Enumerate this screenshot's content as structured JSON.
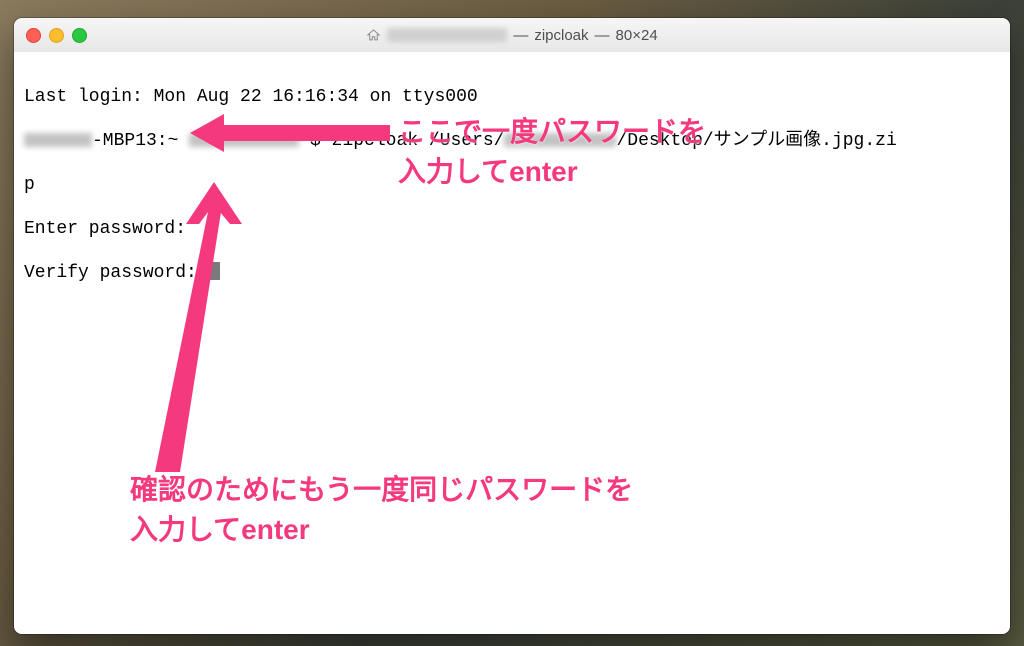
{
  "window": {
    "title_app": "zipcloak",
    "title_size": "80×24",
    "title_sep1": " — ",
    "title_sep2": " — "
  },
  "terminal": {
    "last_login": "Last login: Mon Aug 22 16:16:34 on ttys000",
    "prompt_host_suffix": "-MBP13:~ ",
    "prompt_symbol": "$ ",
    "command_prefix": "zipcloak /Users/",
    "command_suffix": "/Desktop/サンプル画像.jpg.zi",
    "line3": "p",
    "enter_password": "Enter password: ",
    "verify_password": "Verify password: "
  },
  "annotations": {
    "top_line1": "ここで一度パスワードを",
    "top_line2": "入力してenter",
    "bottom_line1": "確認のためにもう一度同じパスワードを",
    "bottom_line2": "入力してenter"
  }
}
